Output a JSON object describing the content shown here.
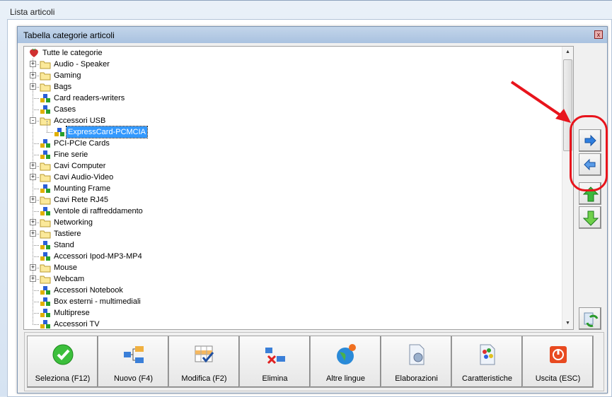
{
  "outer_window": {
    "title": "Lista articoli"
  },
  "dialog": {
    "title": "Tabella categorie articoli",
    "close_label": "x"
  },
  "tree": {
    "root": "Tutte le categorie",
    "items": [
      {
        "label": "Audio - Speaker",
        "icon": "folder",
        "expander": "+"
      },
      {
        "label": "Gaming",
        "icon": "folder",
        "expander": "+"
      },
      {
        "label": "Bags",
        "icon": "folder",
        "expander": "+"
      },
      {
        "label": "Card readers-writers",
        "icon": "group",
        "expander": ""
      },
      {
        "label": "Cases",
        "icon": "group",
        "expander": ""
      },
      {
        "label": "Accessori USB",
        "icon": "folder",
        "expander": "-"
      },
      {
        "label": "ExpressCard-PCMCIA",
        "icon": "group",
        "expander": "",
        "child": true,
        "selected": true
      },
      {
        "label": "PCI-PCIe Cards",
        "icon": "group",
        "expander": ""
      },
      {
        "label": "Fine serie",
        "icon": "group",
        "expander": ""
      },
      {
        "label": "Cavi Computer",
        "icon": "folder",
        "expander": "+"
      },
      {
        "label": "Cavi Audio-Video",
        "icon": "folder",
        "expander": "+"
      },
      {
        "label": "Mounting Frame",
        "icon": "group",
        "expander": ""
      },
      {
        "label": "Cavi Rete RJ45",
        "icon": "folder",
        "expander": "+"
      },
      {
        "label": "Ventole di raffreddamento",
        "icon": "group",
        "expander": ""
      },
      {
        "label": "Networking",
        "icon": "folder",
        "expander": "+"
      },
      {
        "label": "Tastiere",
        "icon": "folder",
        "expander": "+"
      },
      {
        "label": "Stand",
        "icon": "group",
        "expander": ""
      },
      {
        "label": "Accessori Ipod-MP3-MP4",
        "icon": "group",
        "expander": ""
      },
      {
        "label": "Mouse",
        "icon": "folder",
        "expander": "+"
      },
      {
        "label": "Webcam",
        "icon": "folder",
        "expander": "+"
      },
      {
        "label": "Accessori Notebook",
        "icon": "group",
        "expander": ""
      },
      {
        "label": "Box esterni - multimediali",
        "icon": "group",
        "expander": ""
      },
      {
        "label": "Multiprese",
        "icon": "group",
        "expander": ""
      },
      {
        "label": "Accessori TV",
        "icon": "group",
        "expander": ""
      }
    ]
  },
  "side_buttons": [
    "arrow-right",
    "arrow-left",
    "arrow-up",
    "arrow-down",
    "refresh"
  ],
  "bottom_buttons": [
    {
      "label": "Seleziona (F12)",
      "icon": "check"
    },
    {
      "label": "Nuovo (F4)",
      "icon": "new-node"
    },
    {
      "label": "Modifica (F2)",
      "icon": "edit-grid"
    },
    {
      "label": "Elimina",
      "icon": "delete-node"
    },
    {
      "label": "Altre lingue",
      "icon": "globe"
    },
    {
      "label": "Elaborazioni",
      "icon": "gear-doc"
    },
    {
      "label": "Caratteristiche",
      "icon": "features"
    },
    {
      "label": "Uscita (ESC)",
      "icon": "power"
    }
  ],
  "colors": {
    "selection": "#3399ff",
    "highlight": "#e8141c"
  }
}
